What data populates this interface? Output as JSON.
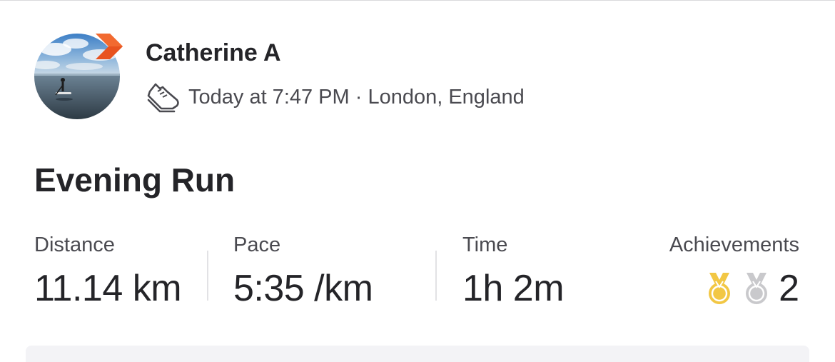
{
  "athlete": {
    "name": "Catherine A",
    "avatar_icon": "paddleboard-photo-avatar",
    "badge_icon": "subscriber-chevron-badge",
    "badge_color": "#E8531F"
  },
  "activity": {
    "sport_icon": "running-shoe-icon",
    "meta": "Today at 7:47 PM · London, England",
    "title": "Evening Run"
  },
  "stats": [
    {
      "label": "Distance",
      "value": "11.14 km"
    },
    {
      "label": "Pace",
      "value": "5:35 /km"
    },
    {
      "label": "Time",
      "value": "1h 2m"
    }
  ],
  "achievements": {
    "label": "Achievements",
    "count": "2",
    "medals": [
      {
        "icon": "gold-medal-icon",
        "color": "#F2C744"
      },
      {
        "icon": "silver-medal-icon",
        "color": "#C9C9CC"
      }
    ]
  }
}
